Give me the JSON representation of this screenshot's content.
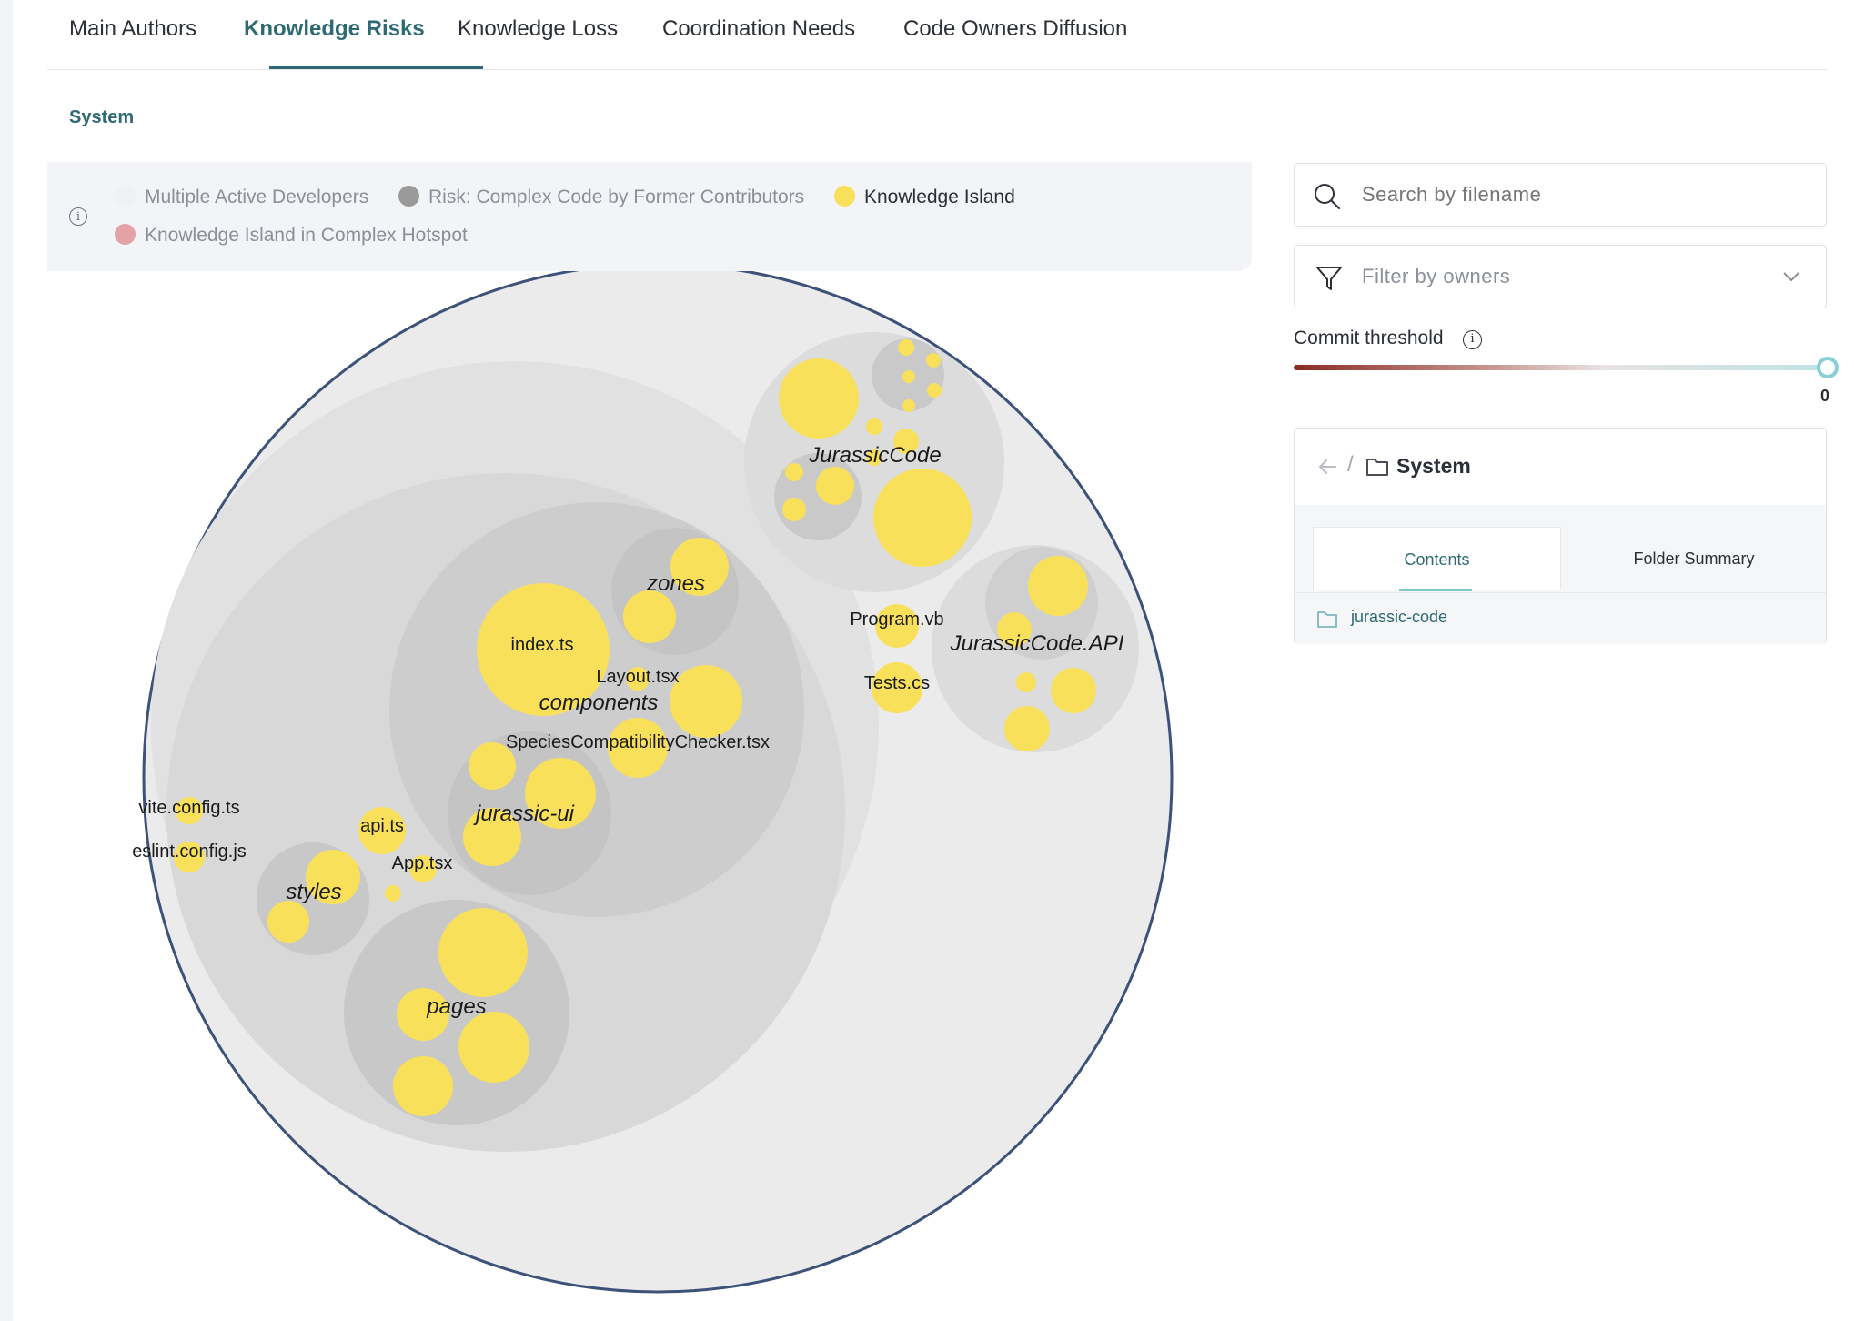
{
  "tabs": [
    {
      "label": "Main Authors"
    },
    {
      "label": "Knowledge Risks"
    },
    {
      "label": "Knowledge Loss"
    },
    {
      "label": "Coordination Needs"
    },
    {
      "label": "Code Owners Diffusion"
    }
  ],
  "breadcrumb_root": "System",
  "legend": {
    "items": [
      {
        "label": "Multiple Active Developers",
        "color": "#f0f1f3"
      },
      {
        "label": "Risk: Complex Code by Former Contributors",
        "color": "#9a9a9a"
      },
      {
        "label": "Knowledge Island",
        "color": "#f9e05a"
      },
      {
        "label": "Knowledge Island in Complex Hotspot",
        "color": "#e3a3a6"
      }
    ]
  },
  "chart_labels": {
    "jurassiccode": "JurassicCode",
    "jurassiccode_api": "JurassicCode.API",
    "zones": "zones",
    "components": "components",
    "jurassic_ui": "jurassic-ui",
    "styles": "styles",
    "pages": "pages",
    "index_ts": "index.ts",
    "layout_tsx": "Layout.tsx",
    "species": "SpeciesCompatibilityChecker.tsx",
    "program_vb": "Program.vb",
    "tests_cs": "Tests.cs",
    "vite_config": "vite.config.ts",
    "eslint_config": "eslint.config.js",
    "api_ts": "api.ts",
    "app_tsx": "App.tsx"
  },
  "search": {
    "placeholder": "Search by filename"
  },
  "filter": {
    "placeholder": "Filter by owners"
  },
  "commit_threshold": {
    "label": "Commit threshold",
    "value": "0"
  },
  "navigator": {
    "folder": "System",
    "separator": "/",
    "tabs": {
      "contents": "Contents",
      "summary": "Folder Summary"
    },
    "items": [
      {
        "label": "jurassic-code"
      }
    ]
  },
  "colors": {
    "accent": "#2e6a73",
    "knowledge_island": "#f9e05a",
    "outline": "#3d5279"
  }
}
